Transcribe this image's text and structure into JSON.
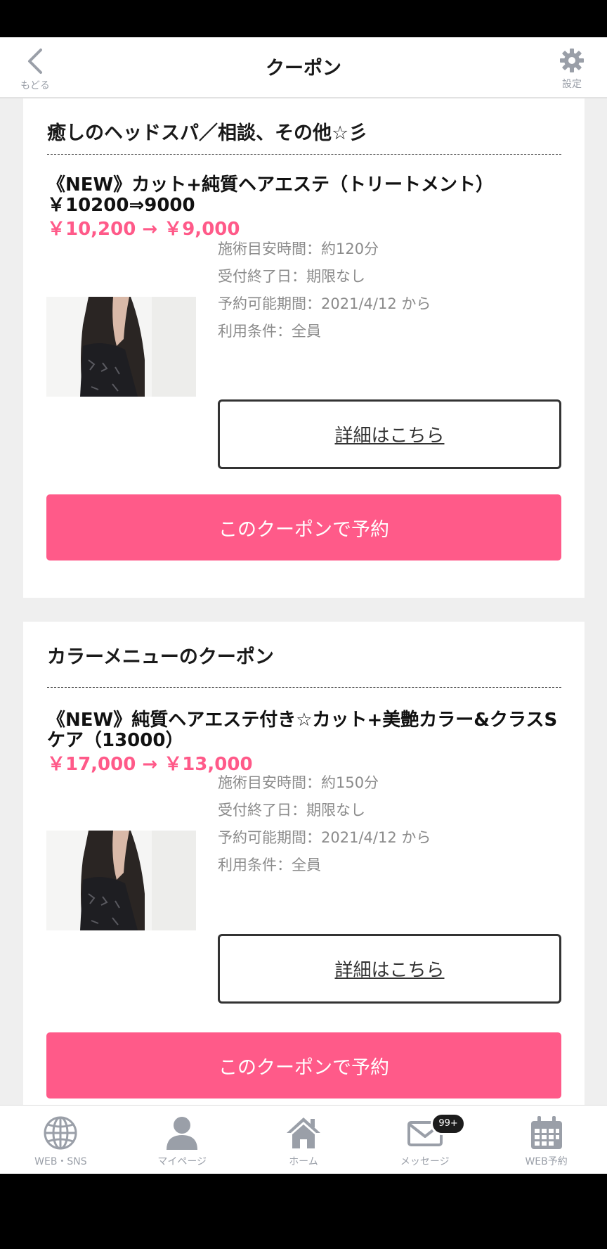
{
  "header": {
    "back_label": "もどる",
    "title": "クーポン",
    "settings_label": "設定"
  },
  "coupons": [
    {
      "category": "癒しのヘッドスパ／相談、その他☆彡",
      "name": "《NEW》カット+純質ヘアエステ（トリートメント）￥10200⇒9000",
      "price": "￥10,200 → ￥9,000",
      "info": [
        "施術目安時間：約120分",
        "受付終了日：期限なし",
        "予約可能期間：2021/4/12 から",
        "利用条件：全員"
      ],
      "detail_label": "詳細はこちら",
      "book_label": "このクーポンで予約"
    },
    {
      "category": "カラーメニューのクーポン",
      "name": "《NEW》純質ヘアエステ付き☆カット+美艶カラー&クラスSケア（13000）",
      "price": "￥17,000 → ￥13,000",
      "info": [
        "施術目安時間：約150分",
        "受付終了日：期限なし",
        "予約可能期間：2021/4/12 から",
        "利用条件：全員"
      ],
      "detail_label": "詳細はこちら",
      "book_label": "このクーポンで予約"
    }
  ],
  "nav": [
    {
      "label": "WEB・SNS",
      "icon": "globe-icon"
    },
    {
      "label": "マイページ",
      "icon": "person-icon"
    },
    {
      "label": "ホーム",
      "icon": "home-icon"
    },
    {
      "label": "メッセージ",
      "icon": "mail-icon",
      "badge": "99+"
    },
    {
      "label": "WEB予約",
      "icon": "calendar-icon"
    }
  ],
  "colors": {
    "accent": "#ff5a89",
    "icon_gray": "#9a9fa8",
    "background": "#efefef"
  }
}
